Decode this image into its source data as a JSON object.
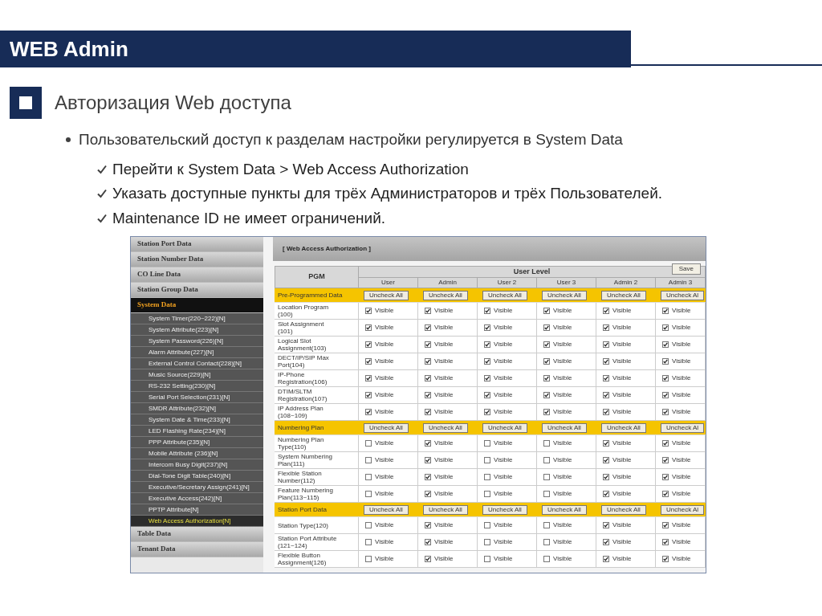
{
  "header": {
    "title": "WEB Admin"
  },
  "heading": "Авторизация Web доступа",
  "bullet": "Пользовательский доступ к разделам настройки регулируется в System Data",
  "checks": [
    "Перейти к System Data > Web Access Authorization",
    "Указать доступные пункты для трёх Администраторов и трёх Пользователей.",
    "Maintenance ID не имеет ограничений."
  ],
  "sidebar": [
    {
      "kind": "section",
      "label": "Station Port Data",
      "selected": false
    },
    {
      "kind": "section",
      "label": "Station Number Data",
      "selected": false
    },
    {
      "kind": "section",
      "label": "CO Line Data",
      "selected": false
    },
    {
      "kind": "section",
      "label": "Station Group Data",
      "selected": false
    },
    {
      "kind": "section",
      "label": "System Data",
      "selected": true
    },
    {
      "kind": "subitem",
      "label": "System Timer(220~222)[N]",
      "selected": false
    },
    {
      "kind": "subitem",
      "label": "System Attribute(223)[N]",
      "selected": false
    },
    {
      "kind": "subitem",
      "label": "System Password(226)[N]",
      "selected": false
    },
    {
      "kind": "subitem",
      "label": "Alarm Attribute(227)[N]",
      "selected": false
    },
    {
      "kind": "subitem",
      "label": "External Control Contact(228)[N]",
      "selected": false
    },
    {
      "kind": "subitem",
      "label": "Music Source(229)[N]",
      "selected": false
    },
    {
      "kind": "subitem",
      "label": "RS-232 Setting(230)[N]",
      "selected": false
    },
    {
      "kind": "subitem",
      "label": "Serial Port Selection(231)[N]",
      "selected": false
    },
    {
      "kind": "subitem",
      "label": "SMDR Attribute(232)[N]",
      "selected": false
    },
    {
      "kind": "subitem",
      "label": "System Date & Time(233)[N]",
      "selected": false
    },
    {
      "kind": "subitem",
      "label": "LED Flashing Rate(234)[N]",
      "selected": false
    },
    {
      "kind": "subitem",
      "label": "PPP Attribute(235)[N]",
      "selected": false
    },
    {
      "kind": "subitem",
      "label": "Mobile Attribute (236)[N]",
      "selected": false
    },
    {
      "kind": "subitem",
      "label": "Intercom Busy Digit(237)[N]",
      "selected": false
    },
    {
      "kind": "subitem",
      "label": "Dial-Tone Digit Table(240)[N]",
      "selected": false
    },
    {
      "kind": "subitem",
      "label": "Executive/Secretary Assign(241)[N]",
      "selected": false
    },
    {
      "kind": "subitem",
      "label": "Executive Access(242)[N]",
      "selected": false
    },
    {
      "kind": "subitem",
      "label": "PPTP Attribute[N]",
      "selected": false
    },
    {
      "kind": "subitem",
      "label": "Web Access Authorization[N]",
      "selected": true
    },
    {
      "kind": "section",
      "label": "Table Data",
      "selected": false
    },
    {
      "kind": "section",
      "label": "Tenant Data",
      "selected": false
    }
  ],
  "panel": {
    "title": "[ Web Access Authorization ]",
    "save": "Save",
    "pgm_header": "PGM",
    "level_header": "User Level",
    "columns": [
      "User",
      "Admin",
      "User 2",
      "User 3",
      "Admin 2",
      "Admin 3"
    ],
    "rows": [
      {
        "kind": "group",
        "label": "Pre-Programmed Data",
        "buttons": [
          "Uncheck All",
          "Uncheck All",
          "Uncheck All",
          "Uncheck All",
          "Uncheck All",
          "Uncheck Al"
        ]
      },
      {
        "kind": "item",
        "label": "Location Program (100)",
        "cells": [
          {
            "label": "Visible",
            "checked": true
          },
          {
            "label": "Visible",
            "checked": true
          },
          {
            "label": "Visible",
            "checked": true
          },
          {
            "label": "Visible",
            "checked": true
          },
          {
            "label": "Visible",
            "checked": true
          },
          {
            "label": "Visible",
            "checked": true
          }
        ]
      },
      {
        "kind": "item",
        "label": "Slot Assignment (101)",
        "cells": [
          {
            "label": "Visible",
            "checked": true
          },
          {
            "label": "Visible",
            "checked": true
          },
          {
            "label": "Visible",
            "checked": true
          },
          {
            "label": "Visible",
            "checked": true
          },
          {
            "label": "Visible",
            "checked": true
          },
          {
            "label": "Visible",
            "checked": true
          }
        ]
      },
      {
        "kind": "item",
        "label": "Logical Slot Assignment(103)",
        "cells": [
          {
            "label": "Visible",
            "checked": true
          },
          {
            "label": "Visible",
            "checked": true
          },
          {
            "label": "Visible",
            "checked": true
          },
          {
            "label": "Visible",
            "checked": true
          },
          {
            "label": "Visible",
            "checked": true
          },
          {
            "label": "Visible",
            "checked": true
          }
        ]
      },
      {
        "kind": "item",
        "label": "DECT/IP/SIP Max Port(104)",
        "cells": [
          {
            "label": "Visible",
            "checked": true
          },
          {
            "label": "Visible",
            "checked": true
          },
          {
            "label": "Visible",
            "checked": true
          },
          {
            "label": "Visible",
            "checked": true
          },
          {
            "label": "Visible",
            "checked": true
          },
          {
            "label": "Visible",
            "checked": true
          }
        ]
      },
      {
        "kind": "item",
        "label": "IP-Phone Registration(106)",
        "cells": [
          {
            "label": "Visible",
            "checked": true
          },
          {
            "label": "Visible",
            "checked": true
          },
          {
            "label": "Visible",
            "checked": true
          },
          {
            "label": "Visible",
            "checked": true
          },
          {
            "label": "Visible",
            "checked": true
          },
          {
            "label": "Visible",
            "checked": true
          }
        ]
      },
      {
        "kind": "item",
        "label": "DTIM/SLTM Registration(107)",
        "cells": [
          {
            "label": "Visible",
            "checked": true
          },
          {
            "label": "Visible",
            "checked": true
          },
          {
            "label": "Visible",
            "checked": true
          },
          {
            "label": "Visible",
            "checked": true
          },
          {
            "label": "Visible",
            "checked": true
          },
          {
            "label": "Visible",
            "checked": true
          }
        ]
      },
      {
        "kind": "item",
        "label": "IP Address Plan (108~109)",
        "cells": [
          {
            "label": "Visible",
            "checked": true
          },
          {
            "label": "Visible",
            "checked": true
          },
          {
            "label": "Visible",
            "checked": true
          },
          {
            "label": "Visible",
            "checked": true
          },
          {
            "label": "Visible",
            "checked": true
          },
          {
            "label": "Visible",
            "checked": true
          }
        ]
      },
      {
        "kind": "group",
        "label": "Numbering Plan",
        "buttons": [
          "Uncheck All",
          "Uncheck All",
          "Uncheck All",
          "Uncheck All",
          "Uncheck All",
          "Uncheck Al"
        ]
      },
      {
        "kind": "item",
        "label": "Numbering Plan Type(110)",
        "cells": [
          {
            "label": "Visible",
            "checked": false
          },
          {
            "label": "Visible",
            "checked": true
          },
          {
            "label": "Visible",
            "checked": false
          },
          {
            "label": "Visible",
            "checked": false
          },
          {
            "label": "Visible",
            "checked": true
          },
          {
            "label": "Visible",
            "checked": true
          }
        ]
      },
      {
        "kind": "item",
        "label": "System Numbering Plan(111)",
        "cells": [
          {
            "label": "Visible",
            "checked": false
          },
          {
            "label": "Visible",
            "checked": true
          },
          {
            "label": "Visible",
            "checked": false
          },
          {
            "label": "Visible",
            "checked": false
          },
          {
            "label": "Visible",
            "checked": true
          },
          {
            "label": "Visible",
            "checked": true
          }
        ]
      },
      {
        "kind": "item",
        "label": "Flexible Station Number(112)",
        "cells": [
          {
            "label": "Visible",
            "checked": false
          },
          {
            "label": "Visible",
            "checked": true
          },
          {
            "label": "Visible",
            "checked": false
          },
          {
            "label": "Visible",
            "checked": false
          },
          {
            "label": "Visible",
            "checked": true
          },
          {
            "label": "Visible",
            "checked": true
          }
        ]
      },
      {
        "kind": "item",
        "label": "Feature Numbering Plan(113~115)",
        "cells": [
          {
            "label": "Visible",
            "checked": false
          },
          {
            "label": "Visible",
            "checked": true
          },
          {
            "label": "Visible",
            "checked": false
          },
          {
            "label": "Visible",
            "checked": false
          },
          {
            "label": "Visible",
            "checked": true
          },
          {
            "label": "Visible",
            "checked": true
          }
        ]
      },
      {
        "kind": "group",
        "label": "Station Port Data",
        "buttons": [
          "Uncheck All",
          "Uncheck All",
          "Uncheck All",
          "Uncheck All",
          "Uncheck All",
          "Uncheck Al"
        ]
      },
      {
        "kind": "item",
        "label": "Station Type(120)",
        "cells": [
          {
            "label": "Visible",
            "checked": false
          },
          {
            "label": "Visible",
            "checked": true
          },
          {
            "label": "Visible",
            "checked": false
          },
          {
            "label": "Visible",
            "checked": false
          },
          {
            "label": "Visible",
            "checked": true
          },
          {
            "label": "Visible",
            "checked": true
          }
        ]
      },
      {
        "kind": "item",
        "label": "Station Port Attribute (121~124)",
        "cells": [
          {
            "label": "Visible",
            "checked": false
          },
          {
            "label": "Visible",
            "checked": true
          },
          {
            "label": "Visible",
            "checked": false
          },
          {
            "label": "Visible",
            "checked": false
          },
          {
            "label": "Visible",
            "checked": true
          },
          {
            "label": "Visible",
            "checked": true
          }
        ]
      },
      {
        "kind": "item",
        "label": "Flexible Button Assignment(126)",
        "cells": [
          {
            "label": "Visible",
            "checked": false
          },
          {
            "label": "Visible",
            "checked": true
          },
          {
            "label": "Visible",
            "checked": false
          },
          {
            "label": "Visible",
            "checked": false
          },
          {
            "label": "Visible",
            "checked": true
          },
          {
            "label": "Visible",
            "checked": true
          }
        ]
      }
    ]
  }
}
